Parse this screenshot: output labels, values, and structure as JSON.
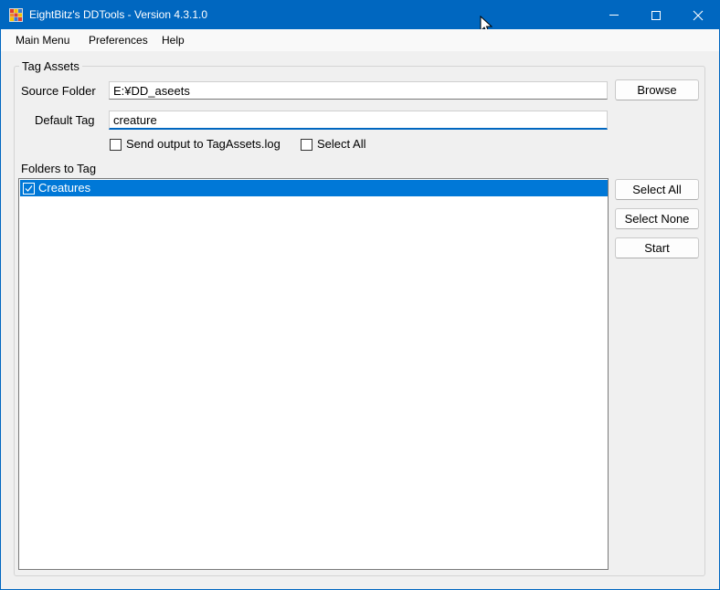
{
  "window": {
    "title": "EightBitz's DDTools - Version 4.3.1.0",
    "accent_color": "#0067c0",
    "controls": [
      "minimize-icon",
      "maximize-icon",
      "close-icon"
    ]
  },
  "menu": {
    "items": [
      "Main Menu",
      "Preferences",
      "Help"
    ]
  },
  "tag_assets": {
    "group_label": "Tag Assets",
    "source_folder_label": "Source Folder",
    "source_folder_value": "E:¥DD_aseets",
    "browse_label": "Browse",
    "default_tag_label": "Default Tag",
    "default_tag_value": "creature",
    "send_output_label": "Send output to TagAssets.log",
    "send_output_checked": false,
    "select_all_check_label": "Select All",
    "select_all_checked": false
  },
  "folders": {
    "label": "Folders to Tag",
    "items": [
      {
        "label": "Creatures",
        "checked": true,
        "selected": true
      }
    ],
    "selection_color": "#0078d7"
  },
  "buttons": {
    "select_all": "Select All",
    "select_none": "Select None",
    "start": "Start"
  }
}
